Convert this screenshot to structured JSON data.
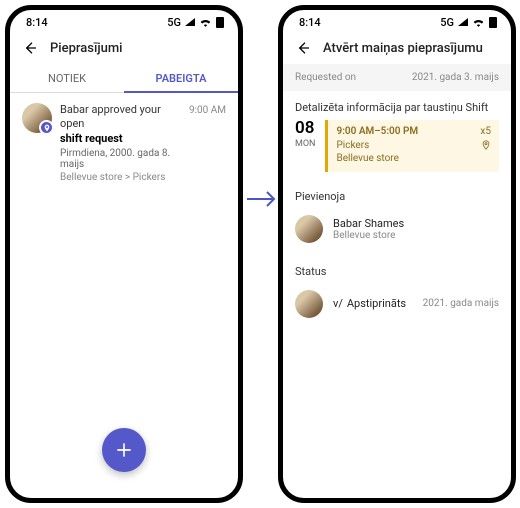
{
  "status_bar": {
    "time": "8:14",
    "network": "5G"
  },
  "left": {
    "header_title": "Pieprasījumi",
    "tabs": {
      "in_progress": "Notiek",
      "completed": "Pabeigta"
    },
    "card": {
      "line_prefix": "Babar approved your open",
      "line_bold": "shift request",
      "date": "Pirmdiena, 2000. gada 8. maijs",
      "location": "Bellevue store > Pickers",
      "time": "9:00 AM"
    }
  },
  "right": {
    "header_title": "Atvērt maiņas pieprasījumu",
    "requested_label": "Requested on",
    "requested_date": "2021. gada 3. maijs",
    "detail_header": "Detalizēta informācija par taustiņu Shift",
    "date_num": "08",
    "date_day": "MON",
    "shift_time": "9:00 AM–5:00 PM",
    "shift_count": "x5",
    "shift_team": "Pickers",
    "shift_store": "Bellevue store",
    "added_by_label": "Pievienoja",
    "person_name": "Babar Shames",
    "person_sub": "Bellevue store",
    "status_label": "Status",
    "status_prefix": "v/",
    "status_value": "Apstiprināts",
    "status_date": "2021. gada maijs"
  }
}
